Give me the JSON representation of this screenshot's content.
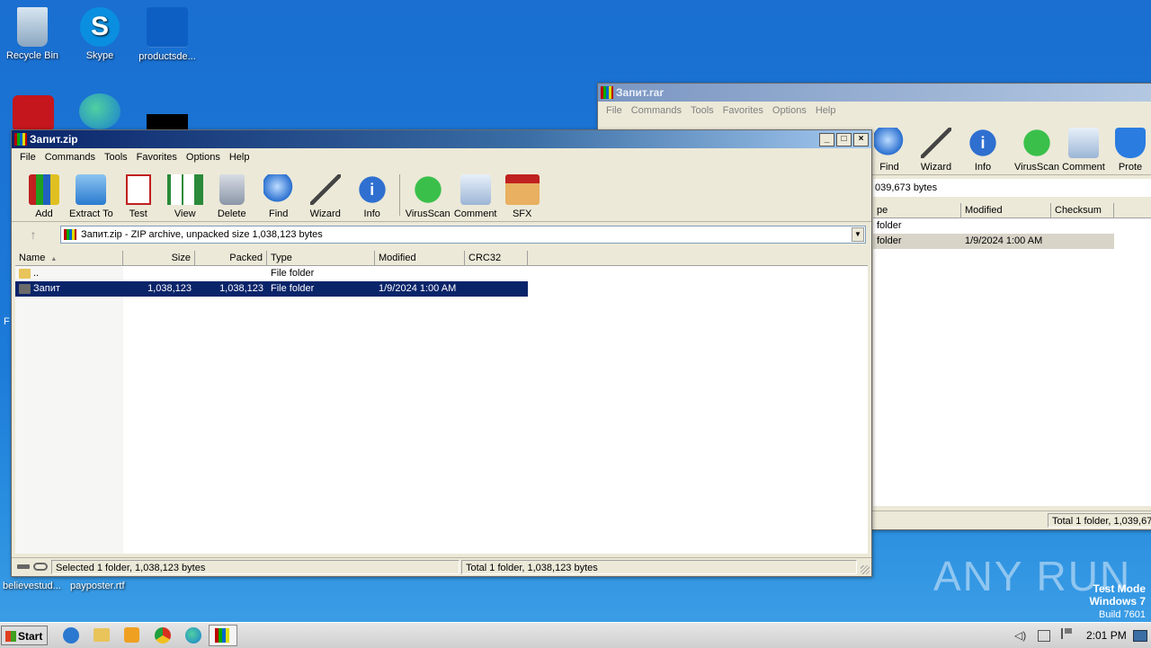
{
  "desktop": {
    "icons": [
      {
        "label": "Recycle Bin"
      },
      {
        "label": "Skype"
      },
      {
        "label": "productsde..."
      }
    ],
    "bottom_labels": [
      "believestud...",
      "payposter.rtf"
    ],
    "left_fragment": "F"
  },
  "watermark": {
    "text": "ANY RUN",
    "test_mode": "Test Mode",
    "os": "Windows 7",
    "build": "Build 7601"
  },
  "back_window": {
    "title": "Запит.rar",
    "menu": [
      "File",
      "Commands",
      "Tools",
      "Favorites",
      "Options",
      "Help"
    ],
    "toolbar": [
      {
        "label": "Find",
        "icon": "find-icon"
      },
      {
        "label": "Wizard",
        "icon": "wizard-icon"
      },
      {
        "label": "Info",
        "icon": "info-icon"
      },
      {
        "label": "VirusScan",
        "icon": "virusscan-icon"
      },
      {
        "label": "Comment",
        "icon": "comment-icon"
      },
      {
        "label": "Prote",
        "icon": "protect-icon"
      }
    ],
    "address_fragment": "039,673 bytes",
    "columns": [
      "pe",
      "Modified",
      "Checksum"
    ],
    "rows": [
      {
        "type": "folder",
        "modified": ""
      },
      {
        "type": "folder",
        "modified": "1/9/2024 1:00 AM"
      }
    ],
    "status_total": "Total 1 folder, 1,039,67"
  },
  "front_window": {
    "title": "Запит.zip",
    "menu": [
      "File",
      "Commands",
      "Tools",
      "Favorites",
      "Options",
      "Help"
    ],
    "toolbar": [
      {
        "label": "Add",
        "icon": "add-icon"
      },
      {
        "label": "Extract To",
        "icon": "extract-to-icon"
      },
      {
        "label": "Test",
        "icon": "test-icon"
      },
      {
        "label": "View",
        "icon": "view-icon"
      },
      {
        "label": "Delete",
        "icon": "delete-icon"
      },
      {
        "label": "Find",
        "icon": "find-icon"
      },
      {
        "label": "Wizard",
        "icon": "wizard-icon"
      },
      {
        "label": "Info",
        "icon": "info-icon"
      },
      {
        "label": "VirusScan",
        "icon": "virusscan-icon"
      },
      {
        "label": "Comment",
        "icon": "comment-icon"
      },
      {
        "label": "SFX",
        "icon": "sfx-icon"
      }
    ],
    "address": "Запит.zip - ZIP archive, unpacked size 1,038,123 bytes",
    "columns": {
      "name": "Name",
      "size": "Size",
      "packed": "Packed",
      "type": "Type",
      "modified": "Modified",
      "crc": "CRC32"
    },
    "rows": [
      {
        "name": "..",
        "size": "",
        "packed": "",
        "type": "File folder",
        "modified": "",
        "crc": "",
        "selected": false
      },
      {
        "name": "Запит",
        "size": "1,038,123",
        "packed": "1,038,123",
        "type": "File folder",
        "modified": "1/9/2024 1:00 AM",
        "crc": "",
        "selected": true
      }
    ],
    "status_selected": "Selected 1 folder, 1,038,123 bytes",
    "status_total": "Total 1 folder, 1,038,123 bytes"
  },
  "taskbar": {
    "start_label": "Start",
    "clock": "2:01 PM",
    "apps": [
      "ie-icon",
      "explorer-icon",
      "media-player-icon",
      "chrome-icon",
      "edge-icon",
      "winrar-icon"
    ]
  },
  "colors": {
    "selection": "#0a246a",
    "accent": "#0a246a",
    "desktop": "#1c7ad8"
  }
}
